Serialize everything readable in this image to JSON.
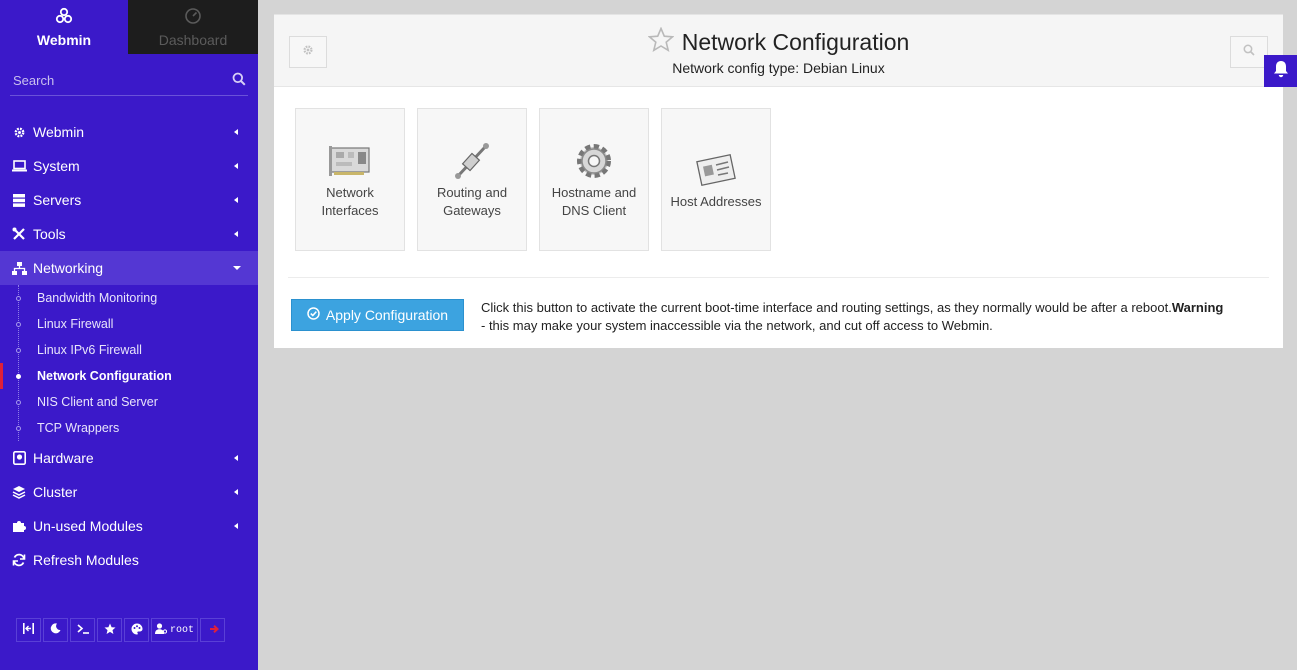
{
  "sidebar": {
    "switch": {
      "webmin_label": "Webmin",
      "dashboard_label": "Dashboard"
    },
    "search_placeholder": "Search",
    "menu": [
      {
        "label": "Webmin",
        "icon": "gear-icon"
      },
      {
        "label": "System",
        "icon": "laptop-icon"
      },
      {
        "label": "Servers",
        "icon": "server-icon"
      },
      {
        "label": "Tools",
        "icon": "tools-icon"
      },
      {
        "label": "Networking",
        "icon": "network-icon"
      },
      {
        "label": "Hardware",
        "icon": "hdd-icon"
      },
      {
        "label": "Cluster",
        "icon": "layers-icon"
      },
      {
        "label": "Un-used Modules",
        "icon": "puzzle-icon"
      },
      {
        "label": "Refresh Modules",
        "icon": "refresh-icon"
      }
    ],
    "networking_items": [
      "Bandwidth Monitoring",
      "Linux Firewall",
      "Linux IPv6 Firewall",
      "Network Configuration",
      "NIS Client and Server",
      "TCP Wrappers"
    ],
    "active_item": "Network Configuration",
    "bottom": {
      "user_label": "root"
    }
  },
  "header": {
    "title": "Network Configuration",
    "subtitle": "Network config type: Debian Linux"
  },
  "modules": [
    {
      "label": "Network Interfaces",
      "icon": "network-card-icon"
    },
    {
      "label": "Routing and Gateways",
      "icon": "cable-icon"
    },
    {
      "label": "Hostname and DNS Client",
      "icon": "cog-icon"
    },
    {
      "label": "Host Addresses",
      "icon": "id-card-icon"
    }
  ],
  "apply": {
    "button_label": "Apply Configuration",
    "description": "Click this button to activate the current boot-time interface and routing settings, as they normally would be after a reboot.",
    "warning_label": "Warning",
    "warning_text": " - this may make your system inaccessible via the network, and cut off access to Webmin."
  },
  "colors": {
    "sidebar": "#3b19c9",
    "accent_active": "#e0203a",
    "button": "#3ca3e0"
  }
}
